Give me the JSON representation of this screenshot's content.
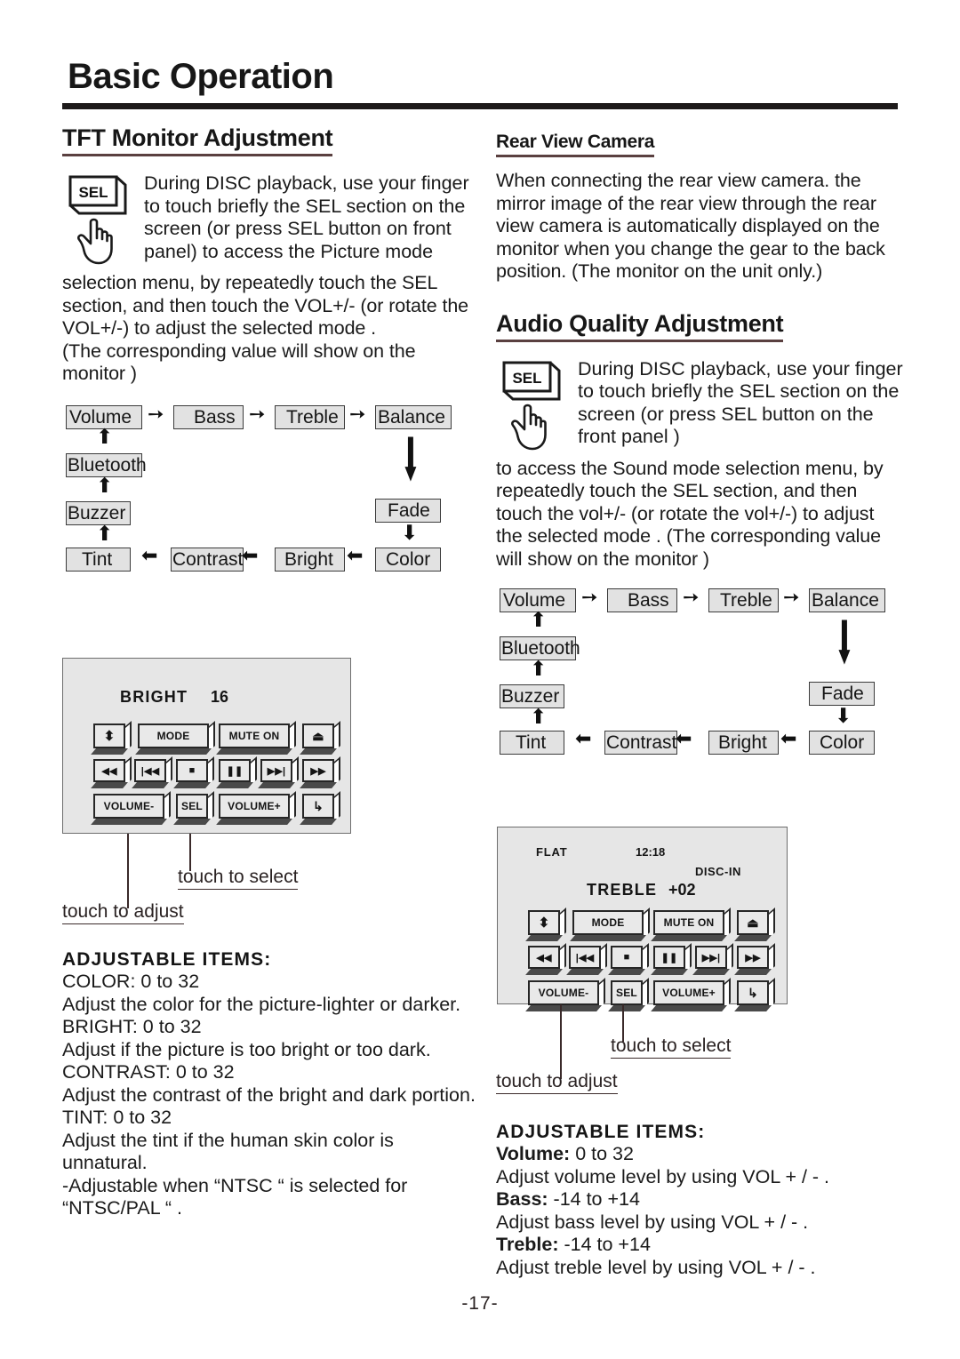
{
  "page": {
    "title": "Basic Operation",
    "footer": "-17-"
  },
  "left_column": {
    "section_title": "TFT Monitor Adjustment",
    "sel_key_label": "SEL",
    "intro_indented": "During DISC playback, use your finger to touch briefly the SEL section on the screen (or press SEL button on front panel) to access the Picture mode",
    "intro_full": "selection menu, by repeatedly touch the SEL section, and then touch the VOL+/- (or rotate the VOL+/-) to adjust the selected mode .\n(The corresponding value will show on the monitor )",
    "flow": {
      "nodes": [
        "Volume",
        "Bass",
        "Treble",
        "Balance",
        "Bluetooth",
        "Fade",
        "Buzzer",
        "Color",
        "Tint",
        "Contrast",
        "Bright"
      ]
    },
    "panel": {
      "display_mode": "BRIGHT",
      "display_value": "16",
      "buttons": {
        "updown": "⬍",
        "mode": "MODE",
        "mute": "MUTE ON",
        "eject": "⏏",
        "rew": "◀◀",
        "prev": "|◀◀",
        "stop": "■",
        "pause": "❚❚",
        "next": "▶▶|",
        "ff": "▶▶",
        "volume_minus": "VOLUME-",
        "sel": "SEL",
        "volume_plus": "VOLUME+",
        "enter": "↳"
      }
    },
    "callout_select": "touch to select",
    "callout_adjust": "touch to adjust",
    "adjustable_heading": "ADJUSTABLE  ITEMS:",
    "adjustable_items": [
      "COLOR: 0 to 32",
      "Adjust the color for the picture-lighter or darker.",
      "BRIGHT: 0 to 32",
      "Adjust if the picture is too bright or too dark.",
      "CONTRAST: 0 to 32",
      "Adjust the contrast of the bright and dark portion.",
      "TINT: 0 to 32",
      "Adjust the tint if the human skin color is unnatural.",
      "-Adjustable when “NTSC “ is selected for “NTSC/PAL “ ."
    ]
  },
  "right_column": {
    "rear_camera_title": "Rear View Camera",
    "rear_camera_text": "When connecting the rear view camera. the mirror image of the rear view through the rear view camera is automatically displayed on the monitor when you change  the gear to the back position. (The monitor on the unit only.)",
    "audio_title": "Audio Quality Adjustment",
    "sel_key_label": "SEL",
    "intro_indented": "During DISC playback, use your finger to touch briefly the SEL section on the screen (or press SEL button on the front panel )",
    "intro_full": "to access the Sound mode selection menu, by repeatedly touch the SEL section, and then touch the vol+/- (or rotate the vol+/-) to adjust the selected mode . (The corresponding value will show on the monitor )",
    "flow": {
      "nodes": [
        "Volume",
        "Bass",
        "Treble",
        "Balance",
        "Bluetooth",
        "Fade",
        "Buzzer",
        "Color",
        "Tint",
        "Contrast",
        "Bright"
      ]
    },
    "panel": {
      "status_left": "FLAT",
      "status_center": "12:18",
      "status_right": "DISC-IN",
      "display_mode": "TREBLE",
      "display_value": "+02",
      "buttons": {
        "updown": "⬍",
        "mode": "MODE",
        "mute": "MUTE ON",
        "eject": "⏏",
        "rew": "◀◀",
        "prev": "|◀◀",
        "stop": "■",
        "pause": "❚❚",
        "next": "▶▶|",
        "ff": "▶▶",
        "volume_minus": "VOLUME-",
        "sel": "SEL",
        "volume_plus": "VOLUME+",
        "enter": "↳"
      }
    },
    "callout_select": "touch to select",
    "callout_adjust": "touch to adjust",
    "adjustable_heading": "ADJUSTABLE  ITEMS:",
    "adjustable_items": [
      {
        "label": "Volume:",
        "range": " 0 to 32",
        "desc": " Adjust volume level by using VOL + / - ."
      },
      {
        "label": "Bass:",
        "range": " -14 to +14",
        "desc": "Adjust bass level by using VOL + / - ."
      },
      {
        "label": "Treble:",
        "range": " -14 to +14",
        "desc": "Adjust treble level by using VOL + / - ."
      }
    ]
  }
}
